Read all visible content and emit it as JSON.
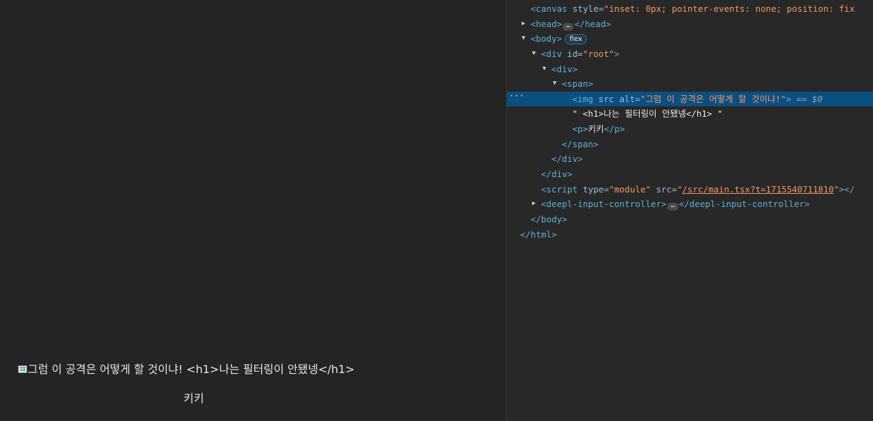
{
  "page": {
    "img_alt": "그럼 이 공격은 어떻게 할 것이냐!",
    "h1_text_node": " <h1>나는 필터링이 안됐넹</h1>",
    "p_text": "키키"
  },
  "devtools": {
    "lines": {
      "canvas": {
        "open": "<canvas",
        "attr": " style=",
        "val": "\"inset: 0px; pointer-events: none; position: fix"
      },
      "head": {
        "open": "<head>",
        "ellipsis": "…",
        "close": "</head>"
      },
      "body": {
        "open": "<body>",
        "badge": "flex"
      },
      "root": {
        "open": "<div",
        "attr": " id=",
        "val": "\"root\"",
        "close": ">"
      },
      "div": {
        "text": "<div>"
      },
      "span": {
        "text": "<span>"
      },
      "img": {
        "open": "<img",
        "attr1": " src",
        "attr2": " alt=",
        "val": "\"그럼 이 공격은 어떻게 할 것이냐!\"",
        "close": ">",
        "eq": " == $0"
      },
      "textnode": {
        "text": "\" <h1>나는 필터링이 안됐넹</h1> \""
      },
      "p": {
        "open": "<p>",
        "text": "키키",
        "close": "</p>"
      },
      "span_close": {
        "text": "</span>"
      },
      "div_close": {
        "text": "</div>"
      },
      "root_close": {
        "text": "</div>"
      },
      "script": {
        "open": "<script",
        "attr1": " type=",
        "val1": "\"module\"",
        "attr2": " src=",
        "val2q": "\"",
        "link": "/src/main.tsx?t=1715540711810",
        "val2e": "\"",
        "close": "></"
      },
      "deepl": {
        "open": "<deepl-input-controller>",
        "ellipsis": "…",
        "close": "</deepl-input-controller>"
      },
      "body_close": {
        "text": "</body>"
      },
      "html_close": {
        "text": "</html>"
      }
    },
    "gutter_dots": "···"
  },
  "colors": {
    "tag": "#5db0d7",
    "attribute": "#9bbbdc",
    "value": "#f29766",
    "selected_row": "#0b4f82",
    "page_background": "#242424"
  }
}
